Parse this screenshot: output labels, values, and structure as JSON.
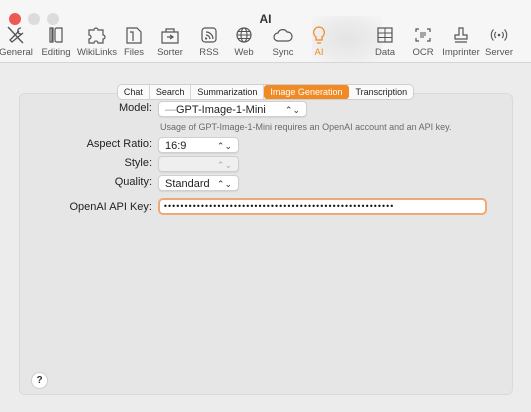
{
  "window": {
    "title": "AI"
  },
  "toolbar": {
    "items": [
      {
        "label": "General",
        "icon": "tools-icon"
      },
      {
        "label": "Editing",
        "icon": "editing-icon"
      },
      {
        "label": "WikiLinks",
        "icon": "puzzle-icon"
      },
      {
        "label": "Files",
        "icon": "files-icon"
      },
      {
        "label": "Sorter",
        "icon": "sorter-icon"
      },
      {
        "label": "RSS",
        "icon": "rss-icon"
      },
      {
        "label": "Web",
        "icon": "globe-icon"
      },
      {
        "label": "Sync",
        "icon": "cloud-icon"
      },
      {
        "label": "AI",
        "icon": "lightbulb-icon"
      },
      {
        "label": "Data",
        "icon": "table-icon"
      },
      {
        "label": "OCR",
        "icon": "ocr-icon"
      },
      {
        "label": "Imprinter",
        "icon": "stamp-icon"
      },
      {
        "label": "Server",
        "icon": "broadcast-icon"
      }
    ],
    "selected": "AI",
    "accent_color": "#f08a24"
  },
  "tabs": [
    {
      "label": "Chat"
    },
    {
      "label": "Search"
    },
    {
      "label": "Summarization"
    },
    {
      "label": "Image Generation"
    },
    {
      "label": "Transcription"
    }
  ],
  "active_tab": "Image Generation",
  "form": {
    "model_label": "Model:",
    "model_value": "GPT-Image-1-Mini",
    "model_prefix": "—",
    "model_caption": "Usage of GPT-Image-1-Mini requires an OpenAI account and an API key.",
    "aspect_label": "Aspect Ratio:",
    "aspect_value": "16:9",
    "style_label": "Style:",
    "style_value": "",
    "quality_label": "Quality:",
    "quality_value": "Standard",
    "api_key_label": "OpenAI API Key:",
    "api_key_value": "••••••••••••••••••••••••••••••••••••••••••••••••••••••••"
  },
  "help": {
    "label": "?"
  },
  "chevron_glyph": "⌃⌄"
}
